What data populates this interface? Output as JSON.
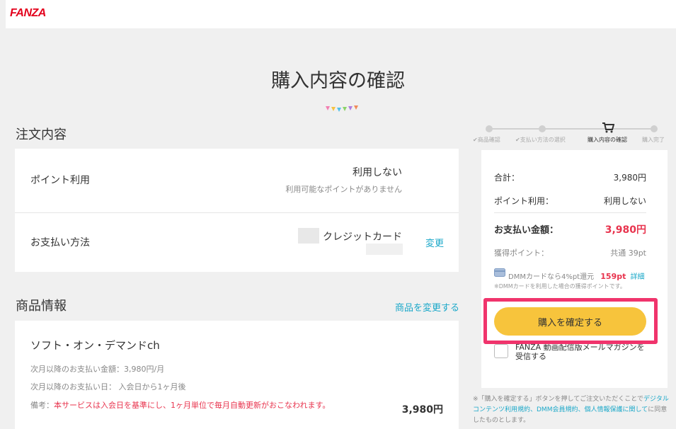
{
  "header": {
    "logo": "FANZA"
  },
  "page_title": "購入内容の確認",
  "order": {
    "section_title": "注文内容",
    "point_label": "ポイント利用",
    "point_value": "利用しない",
    "point_note": "利用可能なポイントがありません",
    "payment_label": "お支払い方法",
    "payment_value": "クレジットカード",
    "change_link": "変更"
  },
  "product": {
    "section_title": "商品情報",
    "change_link": "商品を変更する",
    "name": "ソフト・オン・デマンドch",
    "next_amount": "次月以降のお支払い金額：3,980円/月",
    "next_date": "次月以降のお支払い日： 入会日から1ヶ月後",
    "note_label": "備考：",
    "note_text": "本サービスは入会日を基準にし、1ヶ月単位で毎月自動更新がおこなわれます。",
    "price": "3,980円"
  },
  "stepper": {
    "steps": [
      "商品確認",
      "支払い方法の選択",
      "購入内容の確認",
      "購入完了"
    ],
    "active_index": 2
  },
  "summary": {
    "total_label": "合計：",
    "total_value": "3,980円",
    "point_label": "ポイント利用：",
    "point_value": "利用しない",
    "pay_label": "お支払い金額：",
    "pay_value": "3,980円",
    "earn_label": "獲得ポイント：",
    "earn_value": "共通 39pt",
    "card_promo": "DMMカードなら4%pt還元",
    "card_points": "159pt",
    "card_detail_link": "詳細",
    "card_note": "※DMMカードを利用した場合の獲得ポイントです。",
    "confirm_button": "購入を確定する",
    "newsletter_label": "FANZA 動画配信版メールマガジンを受信する"
  },
  "footer": {
    "prefix": "※「購入を確定する」ボタンを押してご注文いただくことで",
    "links": "デジタルコンテンツ利用規約、DMM会員規約、個人情報保護に関して",
    "suffix": "に同意したものとします。"
  },
  "colors": {
    "brand": "#e3001c",
    "accent": "#f7c43c",
    "highlight": "#f0346c",
    "link": "#1ba8c9",
    "price": "#e8344e"
  },
  "icons": [
    "cart-icon",
    "card-icon",
    "check-icon"
  ]
}
